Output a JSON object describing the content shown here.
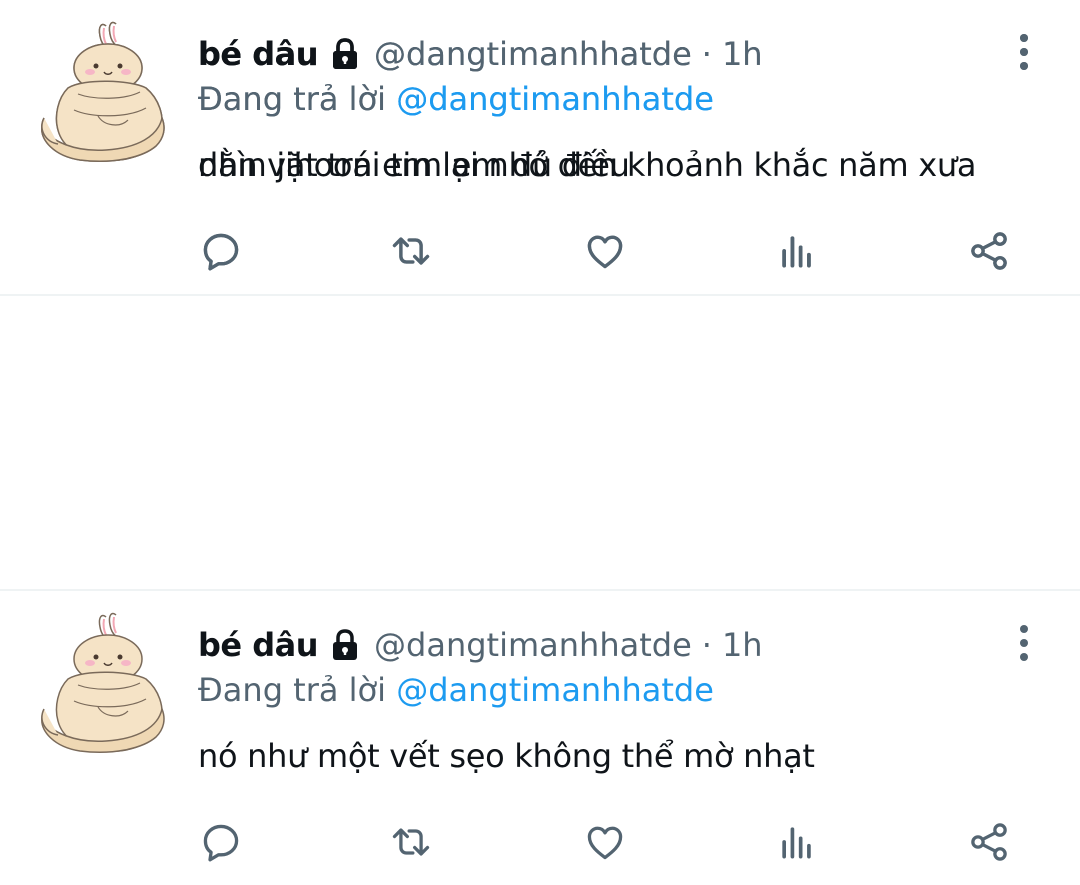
{
  "tweets": [
    {
      "display_name": "bé dâu",
      "handle": "@dangtimanhhatde",
      "separator": "·",
      "time": "1h",
      "reply_prefix": "Đang trả lời",
      "reply_to": "@dangtimanhhatde",
      "text": "nhìn jihoon em lại nhớ đến khoảnh khắc năm xưa"
    },
    {
      "display_name": "bé dâu",
      "handle": "@dangtimanhhatde",
      "separator": "·",
      "time": "1h",
      "reply_prefix": "Đang trả lời",
      "reply_to": "@dangtimanhhatde",
      "text": "nó như một vết sẹo không thể mờ nhạt"
    },
    {
      "display_name": "bé dâu",
      "handle": "@dangtimanhhatde",
      "separator": "·",
      "time": "1h",
      "reply_prefix": "Đang trả lời",
      "reply_to": "@dangtimanhhatde",
      "text": "dằn vặt trái tim em đủ điều"
    }
  ],
  "icons": {
    "lock": "lock-icon",
    "more": "more-vertical-icon",
    "reply": "reply-icon",
    "retweet": "retweet-icon",
    "like": "heart-icon",
    "views": "views-icon",
    "share": "share-icon"
  },
  "colors": {
    "text_primary": "#0f1419",
    "text_secondary": "#536471",
    "mention": "#1d9bf0",
    "divider": "#eff3f4",
    "avatar_body": "#f5e3c6"
  }
}
